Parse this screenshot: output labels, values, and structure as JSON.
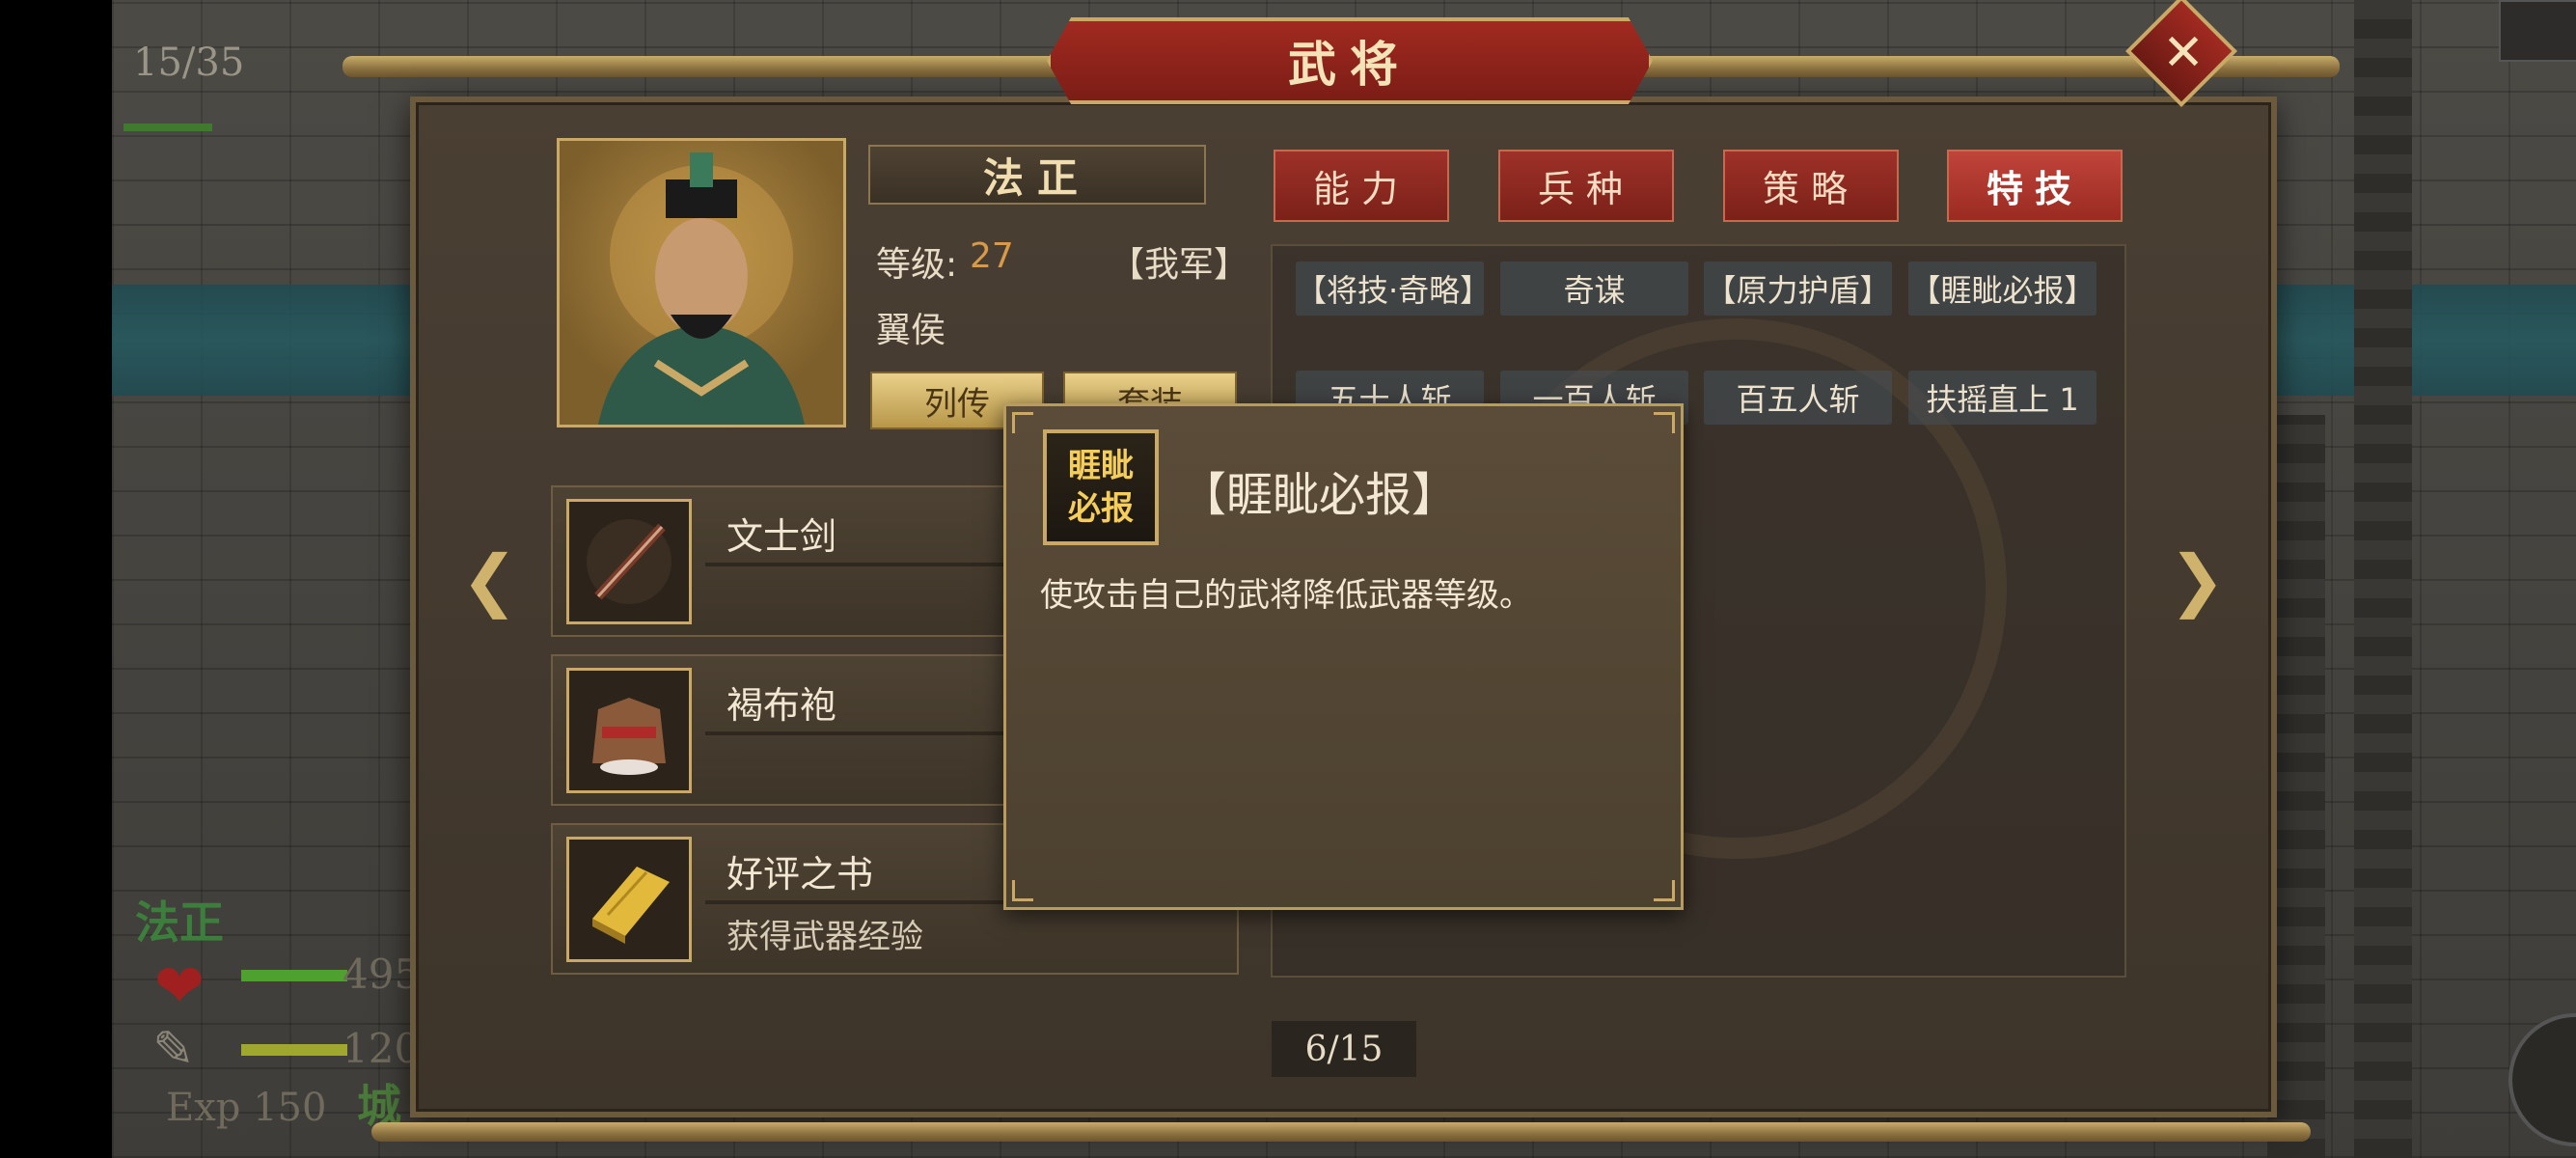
{
  "hud": {
    "count": "15/35",
    "hero_name": "法正",
    "hp": "495",
    "mp": "120",
    "exp": "Exp 150",
    "city": "城"
  },
  "window": {
    "title": "武将"
  },
  "general": {
    "name": "法正",
    "level_label": "等级:",
    "level_value": "27",
    "faction": "【我军】",
    "title": "翼侯",
    "biography_button": "列传",
    "outfit_button": "套装"
  },
  "tabs": [
    {
      "label": "能力",
      "active": false
    },
    {
      "label": "兵种",
      "active": false
    },
    {
      "label": "策略",
      "active": false
    },
    {
      "label": "特技",
      "active": true
    }
  ],
  "skills": [
    "【将技·奇略】",
    "奇谋",
    "【原力护盾】",
    "【睚眦必报】",
    "五十人斩",
    "一百人斩",
    "百五人斩",
    "扶摇直上 1"
  ],
  "equipment": [
    {
      "name": "文士剑",
      "desc": "",
      "icon": "sword-icon"
    },
    {
      "name": "褐布袍",
      "desc": "",
      "icon": "robe-icon"
    },
    {
      "name": "好评之书",
      "desc": "获得武器经验",
      "icon": "book-icon"
    }
  ],
  "pagination": "6/15",
  "tooltip": {
    "icon_text_line1": "睚眦",
    "icon_text_line2": "必报",
    "title": "【睚眦必报】",
    "description": "使攻击自己的武将降低武器等级。"
  },
  "colors": {
    "tab_red": "#9d3128",
    "gold": "#c9a965",
    "panel_brown": "#4a3f33"
  }
}
